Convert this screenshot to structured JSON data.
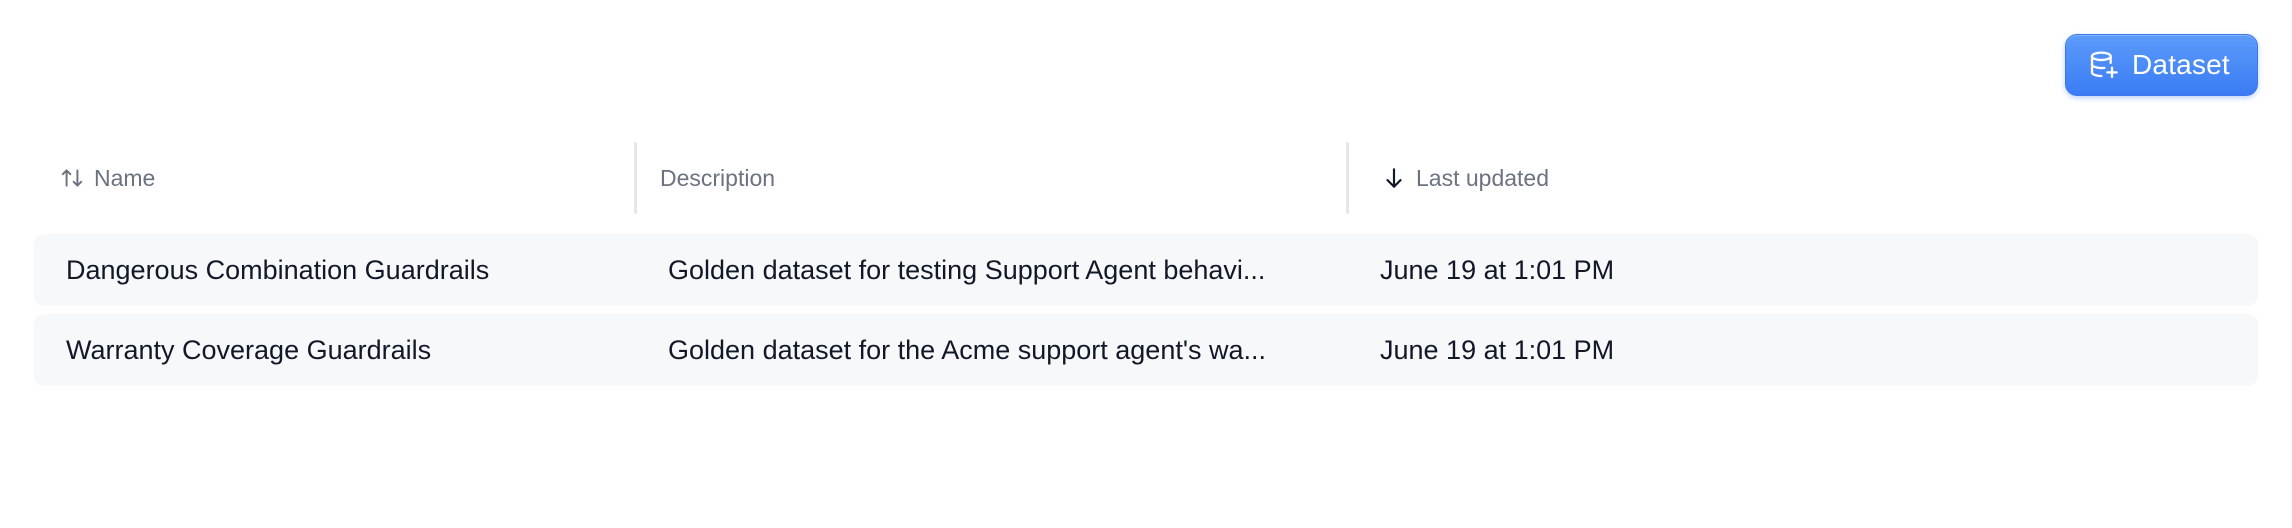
{
  "toolbar": {
    "add_dataset_label": "Dataset",
    "add_dataset_icon": "database-plus-icon",
    "accent_color": "#3b7cf4"
  },
  "table": {
    "columns": [
      {
        "label": "Name",
        "sort_icon": "sort-up-down-icon"
      },
      {
        "label": "Description"
      },
      {
        "label": "Last updated",
        "sort_icon": "arrow-down-icon"
      }
    ],
    "rows": [
      {
        "name": "Dangerous Combination Guardrails",
        "description": "Golden dataset for testing Support Agent behavi...",
        "last_updated": "June 19 at 1:01 PM"
      },
      {
        "name": "Warranty Coverage Guardrails",
        "description": "Golden dataset for the Acme support agent's wa...",
        "last_updated": "June 19 at 1:01 PM"
      }
    ]
  }
}
